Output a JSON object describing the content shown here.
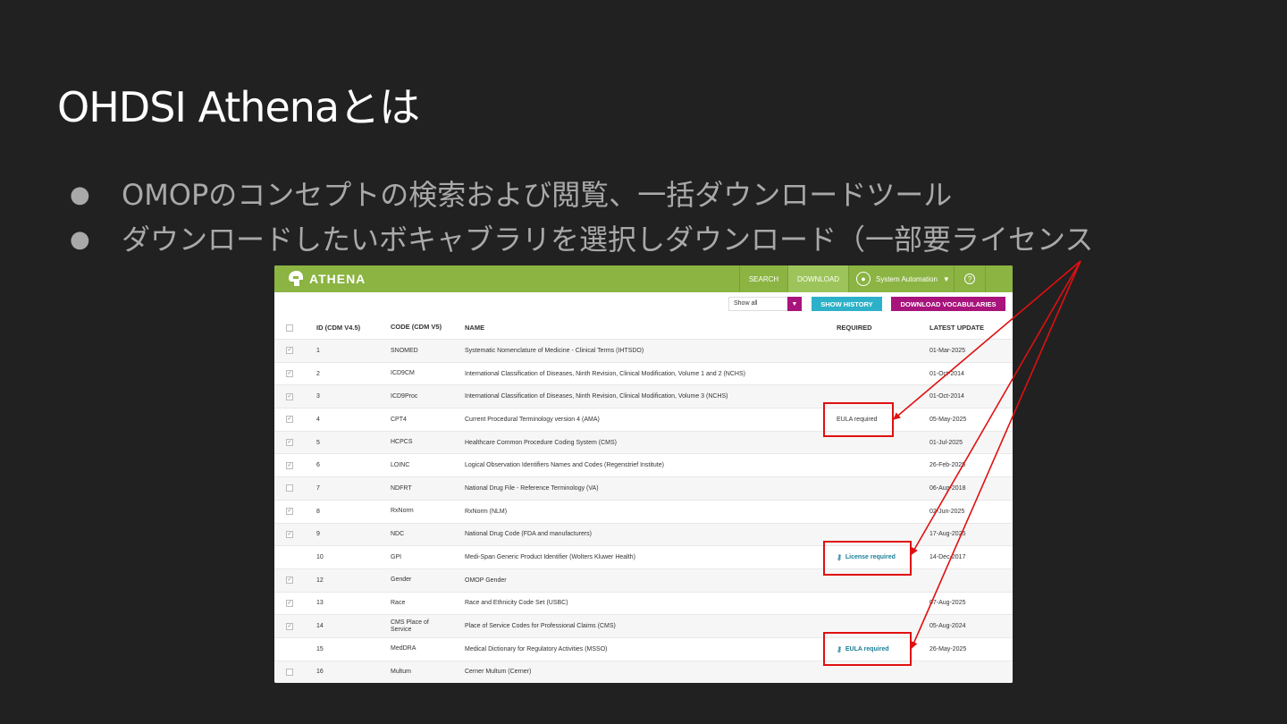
{
  "slide": {
    "title": "OHDSI Athenaとは",
    "bullets": [
      "OMOPのコンセプトの検索および閲覧、一括ダウンロードツール",
      "ダウンロードしたいボキャブラリを選択しダウンロード（一部要ライセンス"
    ],
    "bullet_glyph": "●"
  },
  "app": {
    "logo_text": "ATHENA",
    "nav": {
      "search": "SEARCH",
      "download": "DOWNLOAD",
      "user": "System Automation",
      "user_caret": "▼",
      "help": "?"
    },
    "toolbar": {
      "filter_value": "Show all",
      "filter_arrow": "▼",
      "show_history": "SHOW HISTORY",
      "download_vocabularies": "DOWNLOAD VOCABULARIES"
    },
    "columns": [
      "ID (CDM V4.5)",
      "CODE (CDM V5)",
      "NAME",
      "REQUIRED",
      "LATEST UPDATE"
    ],
    "rows": [
      {
        "checkbox": "checked",
        "id": "1",
        "code": "SNOMED",
        "name": "Systematic Nomenclature of Medicine - Clinical Terms (IHTSDO)",
        "required": "",
        "update": "01-Mar-2025"
      },
      {
        "checkbox": "checked",
        "id": "2",
        "code": "ICD9CM",
        "name": "International Classification of Diseases, Ninth Revision, Clinical Modification, Volume 1 and 2 (NCHS)",
        "required": "",
        "update": "01-Oct-2014"
      },
      {
        "checkbox": "checked",
        "id": "3",
        "code": "ICD9Proc",
        "name": "International Classification of Diseases, Ninth Revision, Clinical Modification, Volume 3 (NCHS)",
        "required": "",
        "update": "01-Oct-2014"
      },
      {
        "checkbox": "checked",
        "id": "4",
        "code": "CPT4",
        "name": "Current Procedural Terminology version 4 (AMA)",
        "required": "EULA required",
        "required_link": false,
        "update": "05-May-2025"
      },
      {
        "checkbox": "checked",
        "id": "5",
        "code": "HCPCS",
        "name": "Healthcare Common Procedure Coding System (CMS)",
        "required": "",
        "update": "01-Jul-2025"
      },
      {
        "checkbox": "checked",
        "id": "6",
        "code": "LOINC",
        "name": "Logical Observation Identifiers Names and Codes (Regenstrief Institute)",
        "required": "",
        "update": "26-Feb-2025"
      },
      {
        "checkbox": "unchecked",
        "id": "7",
        "code": "NDFRT",
        "name": "National Drug File - Reference Terminology (VA)",
        "required": "",
        "update": "06-Aug-2018"
      },
      {
        "checkbox": "checked",
        "id": "8",
        "code": "RxNorm",
        "name": "RxNorm (NLM)",
        "required": "",
        "update": "02-Jun-2025"
      },
      {
        "checkbox": "checked",
        "id": "9",
        "code": "NDC",
        "name": "National Drug Code (FDA and manufacturers)",
        "required": "",
        "update": "17-Aug-2025"
      },
      {
        "checkbox": "none",
        "id": "10",
        "code": "GPI",
        "name": "Medi-Span Generic Product Identifier (Wolters Kluwer Health)",
        "required": "License required",
        "required_link": true,
        "update": "14-Dec-2017"
      },
      {
        "checkbox": "checked",
        "id": "12",
        "code": "Gender",
        "name": "OMOP Gender",
        "required": "",
        "update": ""
      },
      {
        "checkbox": "checked",
        "id": "13",
        "code": "Race",
        "name": "Race and Ethnicity Code Set (USBC)",
        "required": "",
        "update": "07-Aug-2025"
      },
      {
        "checkbox": "checked",
        "id": "14",
        "code": "CMS Place of Service",
        "name": "Place of Service Codes for Professional Claims (CMS)",
        "required": "",
        "update": "05-Aug-2024"
      },
      {
        "checkbox": "none",
        "id": "15",
        "code": "MedDRA",
        "name": "Medical Dictionary for Regulatory Activities (MSSO)",
        "required": "EULA required",
        "required_link": true,
        "update": "26-May-2025"
      },
      {
        "checkbox": "unchecked",
        "id": "16",
        "code": "Multum",
        "name": "Cerner Multum (Cerner)",
        "required": "",
        "update": ""
      }
    ]
  },
  "colors": {
    "background": "#212121",
    "topbar": "#8bb443",
    "magenta": "#a8137c",
    "cyan": "#2db1c8",
    "annotation": "#e01010",
    "link": "#1b7e97"
  },
  "icons": {
    "key": "key-icon",
    "user": "user-icon",
    "help": "help-icon",
    "logo": "athena-helmet-icon"
  }
}
